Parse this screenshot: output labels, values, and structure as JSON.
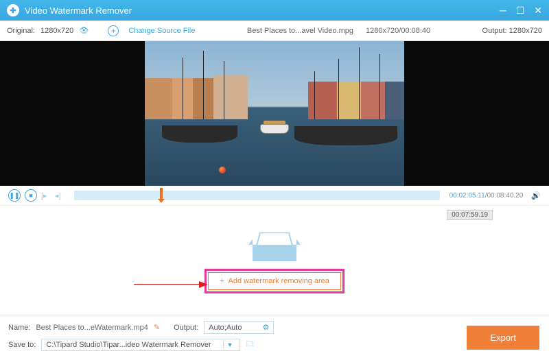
{
  "titlebar": {
    "title": "Video Watermark Remover"
  },
  "toolbar": {
    "original_label": "Original:",
    "original_res": "1280x720",
    "change_source": "Change Source File",
    "filename": "Best Places to...avel Video.mpg",
    "file_res_dur": "1280x720/00:08:40",
    "output_label": "Output:",
    "output_res": "1280x720"
  },
  "playback": {
    "current_time": "00:02:05.11",
    "total_time": "/00:08:40.20"
  },
  "droparea": {
    "badge_time": "00:07:59.19",
    "add_label": "Add watermark removing area"
  },
  "bottom": {
    "name_label": "Name:",
    "name_value": "Best Places to...eWatermark.mp4",
    "output_label": "Output:",
    "output_value": "Auto;Auto",
    "saveto_label": "Save to:",
    "saveto_value": "C:\\Tipard Studio\\Tipar...ideo Watermark Remover",
    "export_label": "Export"
  }
}
